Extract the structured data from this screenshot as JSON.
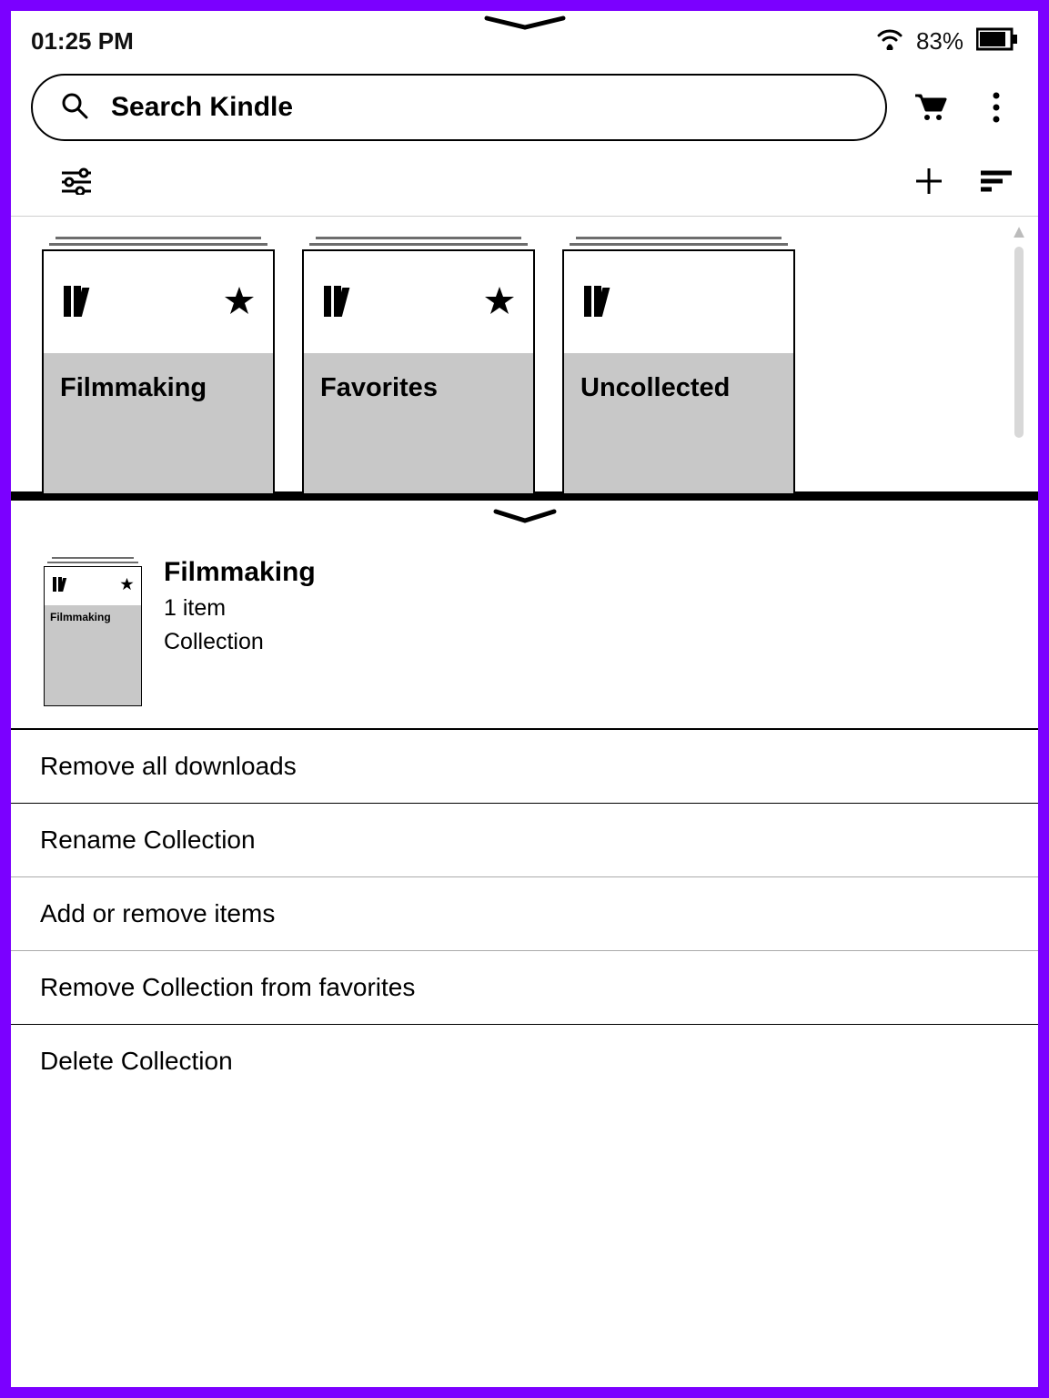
{
  "status": {
    "time": "01:25 PM",
    "battery": "83%"
  },
  "search": {
    "placeholder": "Search Kindle"
  },
  "collections": [
    {
      "title": "Filmmaking",
      "starred": true
    },
    {
      "title": "Favorites",
      "starred": true
    },
    {
      "title": "Uncollected",
      "starred": false
    }
  ],
  "context": {
    "title": "Filmmaking",
    "item_count": "1 item",
    "type": "Collection",
    "mini_label": "Filmmaking",
    "menu": [
      "Remove all downloads",
      "Rename Collection",
      "Add or remove items",
      "Remove Collection from favorites",
      "Delete Collection"
    ]
  }
}
